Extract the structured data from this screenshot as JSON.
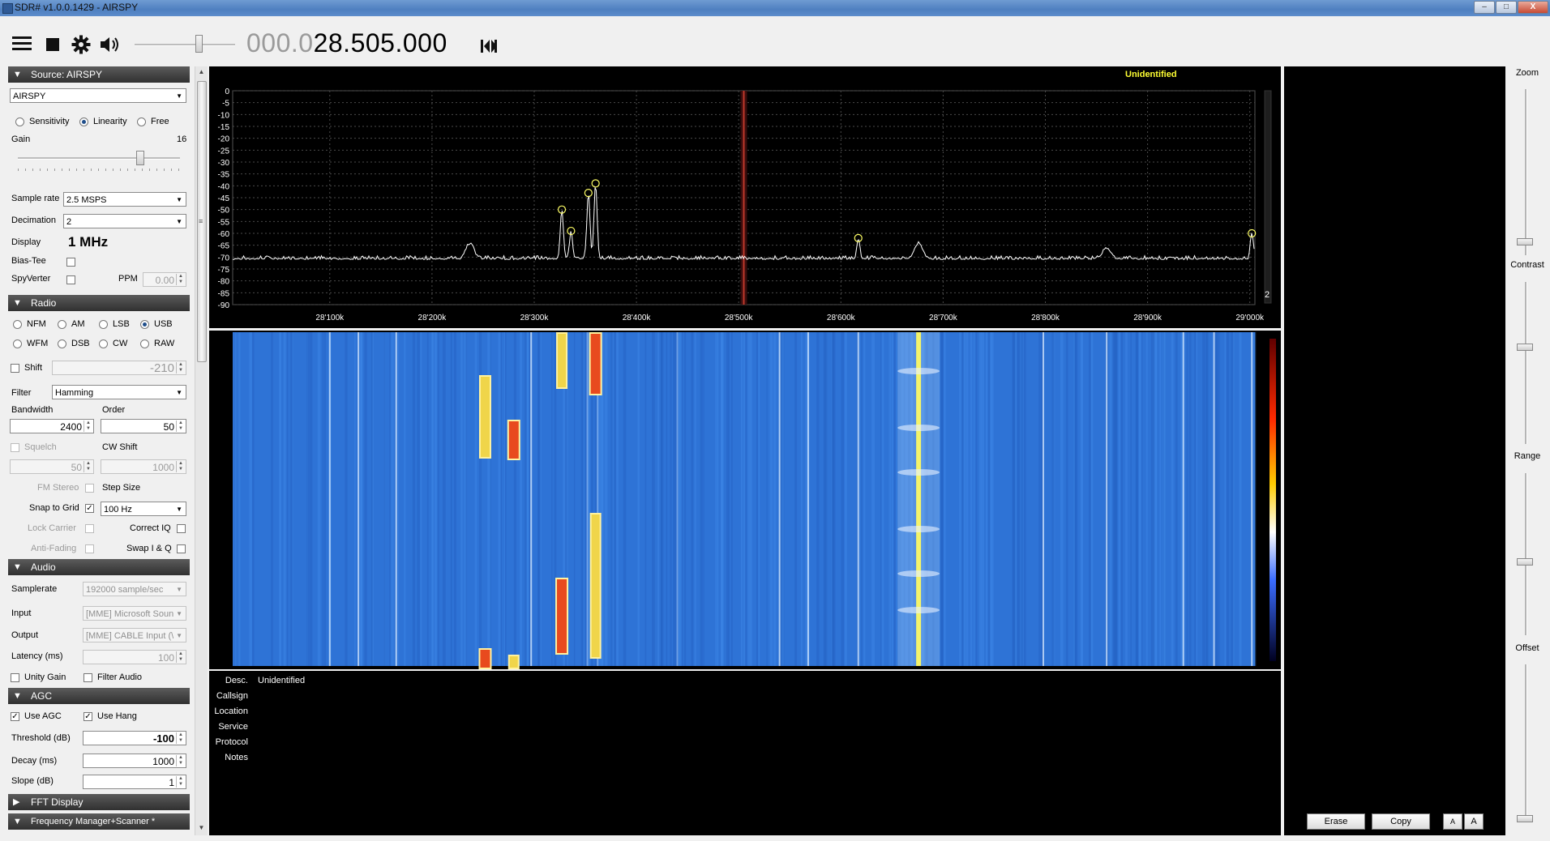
{
  "window": {
    "title": "SDR# v1.0.0.1429 - AIRSPY",
    "minimize_label": "–",
    "maximize_label": "□",
    "close_label": "X"
  },
  "toolbar": {
    "menu_icon": "hamburger-icon",
    "stop_icon": "stop-icon",
    "settings_icon": "gear-icon",
    "audio_icon": "speaker-icon",
    "volume_level": 0.65,
    "frequency_dim": "000.0",
    "frequency_main": "28.505.000",
    "tune_icon": "tune-step-icon"
  },
  "source": {
    "header": "Source: AIRSPY",
    "device": "AIRSPY",
    "modes": [
      "Sensitivity",
      "Linearity",
      "Free"
    ],
    "selected_mode": "Linearity",
    "gain_label": "Gain",
    "gain_value": "16",
    "gain_level": 0.76,
    "sample_rate_label": "Sample rate",
    "sample_rate": "2.5 MSPS",
    "decimation_label": "Decimation",
    "decimation": "2",
    "display_label": "Display",
    "display_value": "1 MHz",
    "bias_tee_label": "Bias-Tee",
    "spyverter_label": "SpyVerter",
    "ppm_label": "PPM",
    "ppm_value": "0.00"
  },
  "radio": {
    "header": "Radio",
    "modes_row1": [
      "NFM",
      "AM",
      "LSB",
      "USB"
    ],
    "modes_row2": [
      "WFM",
      "DSB",
      "CW",
      "RAW"
    ],
    "selected_mode": "USB",
    "shift_label": "Shift",
    "shift_value": "-210",
    "filter_label": "Filter",
    "filter_value": "Hamming",
    "bandwidth_label": "Bandwidth",
    "bandwidth_value": "2400",
    "order_label": "Order",
    "order_value": "50",
    "squelch_label": "Squelch",
    "squelch_value": "50",
    "cw_shift_label": "CW Shift",
    "cw_shift_value": "1000",
    "fm_stereo_label": "FM Stereo",
    "step_size_label": "Step Size",
    "snap_to_grid_label": "Snap to Grid",
    "snap_value": "100 Hz",
    "lock_carrier_label": "Lock Carrier",
    "correct_iq_label": "Correct IQ",
    "anti_fading_label": "Anti-Fading",
    "swap_iq_label": "Swap I & Q",
    "snap_checkmark": "✓"
  },
  "audio": {
    "header": "Audio",
    "samplerate_label": "Samplerate",
    "samplerate_value": "192000 sample/sec",
    "input_label": "Input",
    "input_value": "[MME] Microsoft Soun",
    "output_label": "Output",
    "output_value": "[MME] CABLE Input (\\",
    "latency_label": "Latency (ms)",
    "latency_value": "100",
    "unity_gain_label": "Unity Gain",
    "filter_audio_label": "Filter Audio"
  },
  "agc": {
    "header": "AGC",
    "use_agc_label": "Use AGC",
    "use_hang_label": "Use Hang",
    "threshold_label": "Threshold (dB)",
    "threshold_value": "-100",
    "decay_label": "Decay (ms)",
    "decay_value": "1000",
    "slope_label": "Slope (dB)",
    "slope_value": "1",
    "check_mark": "✓"
  },
  "collapsed_sections": {
    "fft_display": "FFT Display",
    "frequency_manager": "Frequency Manager+Scanner *"
  },
  "spectrum": {
    "signal_label": "Unidentified",
    "corner_label": "2"
  },
  "info": {
    "fields": [
      {
        "label": "Desc.",
        "value": "Unidentified"
      },
      {
        "label": "Callsign",
        "value": ""
      },
      {
        "label": "Location",
        "value": ""
      },
      {
        "label": "Service",
        "value": ""
      },
      {
        "label": "Protocol",
        "value": ""
      },
      {
        "label": "Notes",
        "value": ""
      }
    ]
  },
  "right_panel": {
    "erase_label": "Erase",
    "copy_label": "Copy",
    "font_small_label": "A",
    "font_large_label": "A"
  },
  "sliders": {
    "zoom_label": "Zoom",
    "zoom_level": 0.06,
    "contrast_label": "Contrast",
    "contrast_level": 0.6,
    "range_label": "Range",
    "range_level": 0.45,
    "offset_label": "Offset",
    "offset_level": 0.0
  },
  "colors": {
    "background_panel": "#000000",
    "trace": "#ffffff",
    "grid": "#4a4a4a",
    "marker": "#ffff66",
    "tuned_line": "#c0392b",
    "waterfall_base": "#2e73d6"
  },
  "chart_data": {
    "type": "line",
    "title": "",
    "xlabel": "",
    "ylabel": "",
    "x_unit": "kHz",
    "x_ticks": [
      "28'100k",
      "28'200k",
      "28'300k",
      "28'400k",
      "28'500k",
      "28'600k",
      "28'700k",
      "28'800k",
      "28'900k",
      "29'000k"
    ],
    "y_ticks": [
      "0",
      "-5",
      "-10",
      "-15",
      "-20",
      "-25",
      "-30",
      "-35",
      "-40",
      "-45",
      "-50",
      "-55",
      "-60",
      "-65",
      "-70",
      "-75",
      "-80",
      "-85",
      "-90"
    ],
    "xlim": [
      28005,
      29005
    ],
    "ylim": [
      -90,
      0
    ],
    "noise_floor_db": -71,
    "tuned_frequency_khz": 28505,
    "peaks": [
      {
        "x": 28327,
        "y": -50
      },
      {
        "x": 28336,
        "y": -59
      },
      {
        "x": 28353,
        "y": -43
      },
      {
        "x": 28360,
        "y": -39
      },
      {
        "x": 28617,
        "y": -62
      },
      {
        "x": 29002,
        "y": -60
      }
    ],
    "bumps": [
      {
        "x": 28237,
        "y": -64
      },
      {
        "x": 28676,
        "y": -64
      },
      {
        "x": 28860,
        "y": -66
      }
    ]
  }
}
